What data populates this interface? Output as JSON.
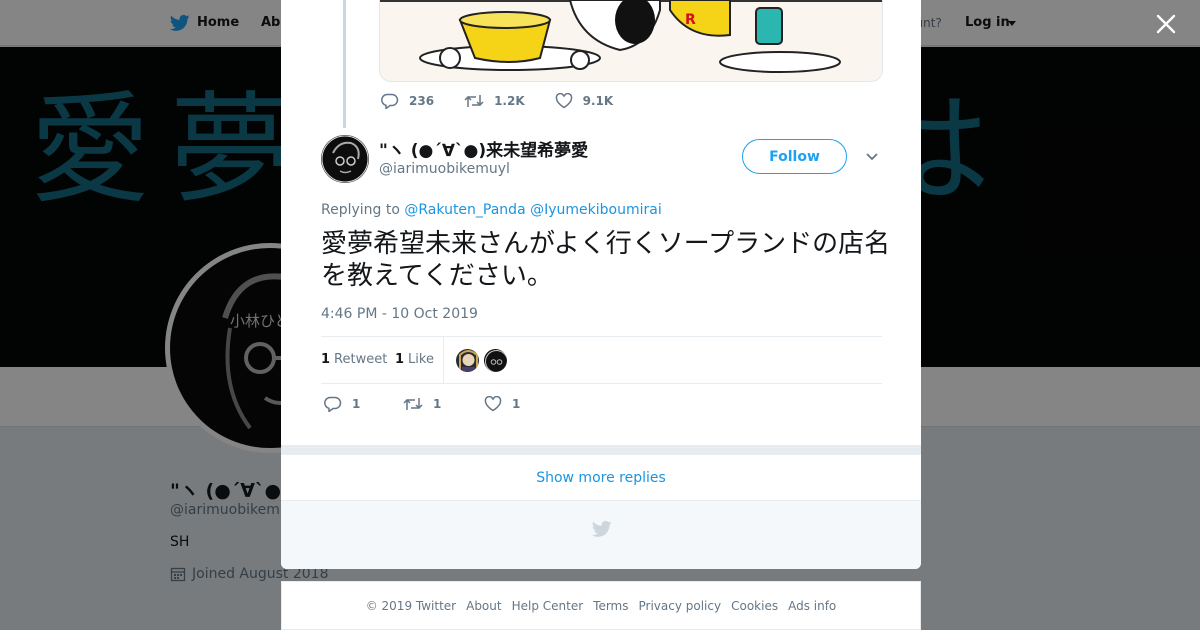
{
  "topbar": {
    "home_label": "Home",
    "about_label": "About",
    "account_text": "ccount?",
    "login_label": "Log in"
  },
  "banner": {
    "text": "愛夢希望未来は"
  },
  "profile": {
    "name": "\"ヽ (●ˊ∀ˋ●)来未望希夢愛",
    "handle": "@iarimuobikemuyl",
    "bio": "SH",
    "joined": "Joined August 2018",
    "avatar_label": "小林ひと"
  },
  "previous_tweet": {
    "replies": "236",
    "retweets": "1.2K",
    "likes": "9.1K"
  },
  "tweet": {
    "display_name": "\"ヽ (●ˊ∀ˋ●)来未望希夢愛",
    "handle": "@iarimuobikemuyl",
    "follow_label": "Follow",
    "replying_prefix": "Replying to",
    "mentions": [
      "@Rakuten_Panda",
      "@Iyumekiboumirai"
    ],
    "text": "愛夢希望未来さんがよく行くソープランドの店名を教えてください。",
    "timestamp": "4:46 PM - 10 Oct 2019",
    "retweet_count": "1",
    "retweet_label": "Retweet",
    "like_count": "1",
    "like_label": "Like",
    "action_replies": "1",
    "action_retweets": "1",
    "action_likes": "1"
  },
  "show_more_label": "Show more replies",
  "footer": {
    "links": [
      "© 2019 Twitter",
      "About",
      "Help Center",
      "Terms",
      "Privacy policy",
      "Cookies",
      "Ads info"
    ]
  },
  "colors": {
    "accent": "#1da1f2",
    "link": "#1b95e0",
    "muted": "#657786",
    "like_pink": "#e0245e"
  },
  "icons": [
    "twitter-bird-icon",
    "close-icon",
    "reply-icon",
    "retweet-icon",
    "heart-icon",
    "chevron-down-icon",
    "calendar-icon"
  ]
}
